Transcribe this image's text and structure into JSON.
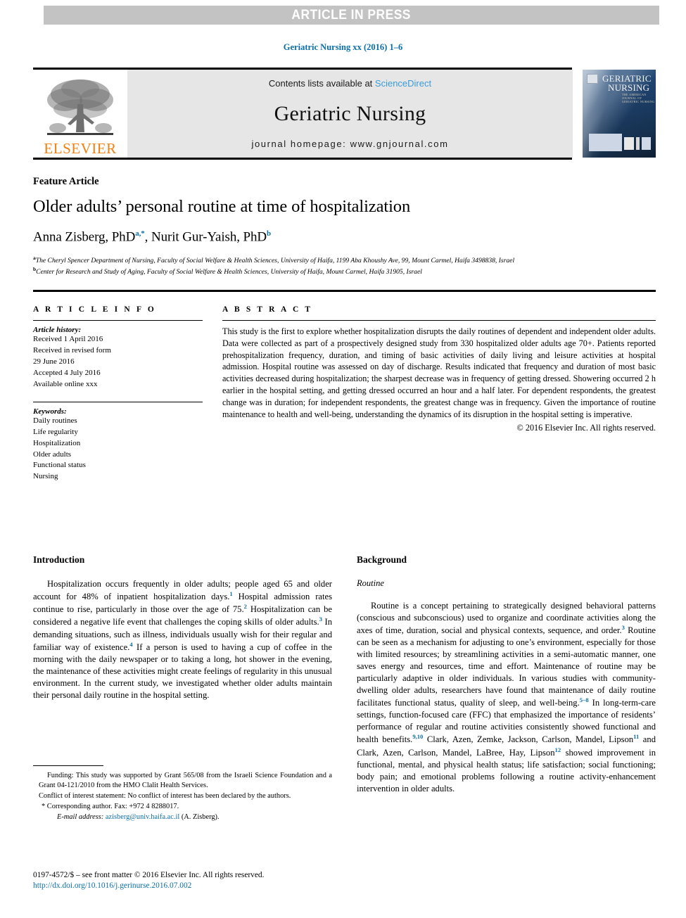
{
  "banner": {
    "text": "ARTICLE IN PRESS"
  },
  "citation": "Geriatric Nursing xx (2016) 1–6",
  "masthead": {
    "contents_prefix": "Contents lists available at ",
    "sciencedirect": "ScienceDirect",
    "journal_name": "Geriatric Nursing",
    "homepage": "journal homepage: www.gnjournal.com",
    "publisher": "ELSEVIER",
    "cover_title_line1": "GERIATRIC",
    "cover_title_line2": "NURSING",
    "cover_subtitle": "THE AMERICAN JOURNAL OF GERIATRIC NURSING"
  },
  "article": {
    "type": "Feature Article",
    "title": "Older adults’ personal routine at time of hospitalization",
    "authors": [
      {
        "name": "Anna Zisberg, PhD",
        "marks": "a,*"
      },
      {
        "name": "Nurit Gur-Yaish, PhD",
        "marks": "b"
      }
    ],
    "authors_line": "Anna Zisberg, PhD",
    "author2_line": ", Nurit Gur-Yaish, PhD",
    "affiliations": [
      {
        "label": "a",
        "text": "The Cheryl Spencer Department of Nursing, Faculty of Social Welfare & Health Sciences, University of Haifa, 1199 Aba Khoushy Ave, 99, Mount Carmel, Haifa 3498838, Israel"
      },
      {
        "label": "b",
        "text": "Center for Research and Study of Aging, Faculty of Social Welfare & Health Sciences, University of Haifa, Mount Carmel, Haifa 31905, Israel"
      }
    ]
  },
  "article_info": {
    "heading": "A R T I C L E  I N F O",
    "history_label": "Article history:",
    "history": [
      "Received 1 April 2016",
      "Received in revised form",
      "29 June 2016",
      "Accepted 4 July 2016",
      "Available online xxx"
    ],
    "keywords_label": "Keywords:",
    "keywords": [
      "Daily routines",
      "Life regularity",
      "Hospitalization",
      "Older adults",
      "Functional status",
      "Nursing"
    ]
  },
  "abstract": {
    "heading": "A B S T R A C T",
    "text": "This study is the first to explore whether hospitalization disrupts the daily routines of dependent and independent older adults. Data were collected as part of a prospectively designed study from 330 hospitalized older adults age 70+. Patients reported prehospitalization frequency, duration, and timing of basic activities of daily living and leisure activities at hospital admission. Hospital routine was assessed on day of discharge. Results indicated that frequency and duration of most basic activities decreased during hospitalization; the sharpest decrease was in frequency of getting dressed. Showering occurred 2 h earlier in the hospital setting, and getting dressed occurred an hour and a half later. For dependent respondents, the greatest change was in duration; for independent respondents, the greatest change was in frequency. Given the importance of routine maintenance to health and well-being, understanding the dynamics of its disruption in the hospital setting is imperative.",
    "copyright": "© 2016 Elsevier Inc. All rights reserved."
  },
  "body": {
    "left": {
      "heading": "Introduction",
      "paragraph_parts": [
        "Hospitalization occurs frequently in older adults; people aged 65 and older account for 48% of inpatient hospitalization days.",
        "1",
        " Hospital admission rates continue to rise, particularly in those over the age of 75.",
        "2",
        " Hospitalization can be considered a negative life event that challenges the coping skills of older adults.",
        "3",
        " In demanding situations, such as illness, individuals usually wish for their regular and familiar way of existence.",
        "4",
        " If a person is used to having a cup of coffee in the morning with the daily newspaper or to taking a long, hot shower in the evening, the maintenance of these activities might create feelings of regularity in this unusual environment. In the current study, we investigated whether older adults maintain their personal daily routine in the hospital setting."
      ]
    },
    "right": {
      "heading": "Background",
      "subheading": "Routine",
      "paragraph_parts": [
        "Routine is a concept pertaining to strategically designed behavioral patterns (conscious and subconscious) used to organize and coordinate activities along the axes of time, duration, social and physical contexts, sequence, and order.",
        "3",
        " Routine can be seen as a mechanism for adjusting to one’s environment, especially for those with limited resources; by streamlining activities in a semi-automatic manner, one saves energy and resources, time and effort. Maintenance of routine may be particularly adaptive in older individuals. In various studies with community-dwelling older adults, researchers have found that maintenance of daily routine facilitates functional status, quality of sleep, and well-being.",
        "5–8",
        " In long-term-care settings, function-focused care (FFC) that emphasized the importance of residents’ performance of regular and routine activities consistently showed functional and health benefits.",
        "9,10",
        " Clark, Azen, Zemke, Jackson, Carlson, Mandel, Lipson",
        "11",
        " and Clark, Azen, Carlson, Mandel, LaBree, Hay, Lipson",
        "12",
        " showed improvement in functional, mental, and physical health status; life satisfaction; social functioning; body pain; and emotional problems following a routine activity-enhancement intervention in older adults."
      ]
    }
  },
  "footnotes": {
    "funding": "Funding: This study was supported by Grant 565/08 from the Israeli Science Foundation and a Grant 04-121/2010 from the HMO Clalit Health Services.",
    "conflict": "Conflict of interest statement: No conflict of interest has been declared by the authors.",
    "corresponding": "* Corresponding author. Fax: +972 4 8288017.",
    "email_label": "E-mail address:",
    "email": "azisberg@univ.haifa.ac.il",
    "email_suffix": " (A. Zisberg)."
  },
  "imprint": {
    "issn_line": "0197-4572/$ – see front matter © 2016 Elsevier Inc. All rights reserved.",
    "doi": "http://dx.doi.org/10.1016/j.gerinurse.2016.07.002"
  },
  "colors": {
    "banner_gray": "#c3c3c3",
    "link_blue": "#0b6ea8",
    "sciencedirect_blue": "#3a9bd9",
    "elsevier_orange": "#f08010",
    "box_gray": "#e6e6e6"
  }
}
